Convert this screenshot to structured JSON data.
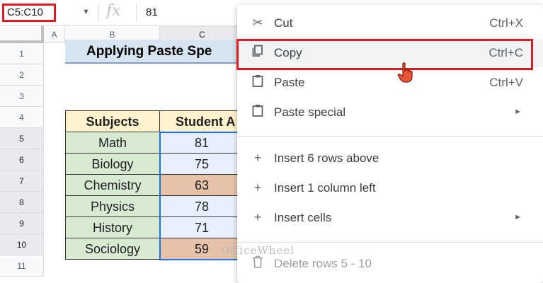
{
  "formula_bar": {
    "name_box": "C5:C10",
    "fx_symbol": "fx",
    "value": "81"
  },
  "columns": [
    "A",
    "B",
    "C"
  ],
  "rows": [
    "1",
    "2",
    "3",
    "4",
    "5",
    "6",
    "7",
    "8",
    "9",
    "10",
    "11"
  ],
  "sheet": {
    "title": "Applying Paste Spe",
    "header_subjects": "Subjects",
    "header_student": "Student A",
    "subjects": [
      "Math",
      "Biology",
      "Chemistry",
      "Physics",
      "History",
      "Sociology"
    ],
    "values": [
      "81",
      "75",
      "63",
      "78",
      "71",
      "59"
    ]
  },
  "menu": {
    "items": [
      {
        "icon": "scissors-icon",
        "label": "Cut",
        "shortcut": "Ctrl+X"
      },
      {
        "icon": "copy-icon",
        "label": "Copy",
        "shortcut": "Ctrl+C"
      },
      {
        "icon": "clipboard-icon",
        "label": "Paste",
        "shortcut": "Ctrl+V"
      },
      {
        "icon": "clipboard-icon",
        "label": "Paste special",
        "arrow": "►"
      },
      {
        "icon": "plus-icon",
        "label": "Insert 6 rows above"
      },
      {
        "icon": "plus-icon",
        "label": "Insert 1 column left"
      },
      {
        "icon": "plus-icon",
        "label": "Insert cells",
        "arrow": "►"
      },
      {
        "icon": "trash-icon",
        "label": "Delete rows 5 - 10"
      }
    ]
  },
  "watermark": "OfficeWheel",
  "colors": {
    "highlight_red": "#e01b24",
    "selection_blue": "#1a73e8",
    "header_yellow": "#fff2cc",
    "subject_green": "#d9ead3",
    "value_blue": "#e8f0fe",
    "value_highlight": "#e6c3a8"
  }
}
